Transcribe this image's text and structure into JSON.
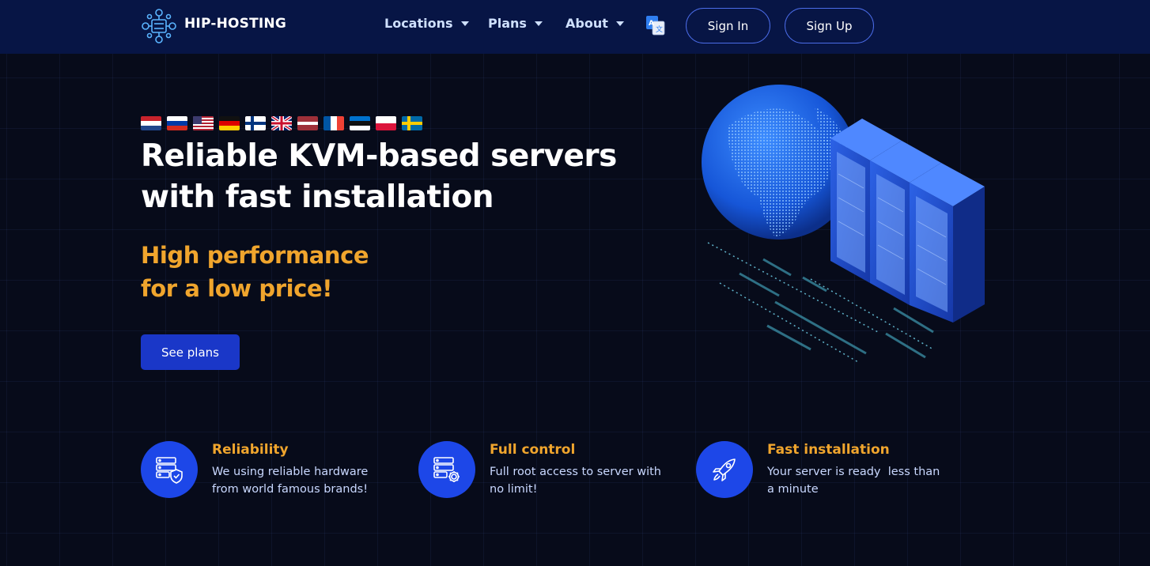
{
  "header": {
    "brand": "HIP-HOSTING",
    "nav": [
      {
        "label": "Locations"
      },
      {
        "label": "Plans"
      },
      {
        "label": "About"
      }
    ],
    "sign_in": "Sign In",
    "sign_up": "Sign Up",
    "translate_icon": "translate-icon"
  },
  "hero": {
    "flags": [
      "netherlands",
      "russia",
      "usa",
      "germany",
      "finland",
      "united-kingdom",
      "latvia",
      "france",
      "estonia",
      "poland",
      "sweden"
    ],
    "title_line1": "Reliable KVM-based servers",
    "title_line2": "with fast installation",
    "subtitle_line1": "High performance",
    "subtitle_line2": "for a low price!",
    "cta": "See plans"
  },
  "features": [
    {
      "icon": "server-shield-icon",
      "title": "Reliability",
      "text_line1": "We using reliable hardware",
      "text_line2": "from world famous brands!"
    },
    {
      "icon": "server-gear-icon",
      "title": "Full control",
      "text_line1": "Full root access to server with",
      "text_line2": "no limit!"
    },
    {
      "icon": "rocket-icon",
      "title": "Fast installation",
      "text_line1": "Your server is ready  less than",
      "text_line2": "a minute"
    }
  ],
  "colors": {
    "background": "#070b1a",
    "header": "#071545",
    "accent_orange": "#f0a52d",
    "accent_blue": "#1d47e8",
    "button_blue": "#1a37c8"
  }
}
